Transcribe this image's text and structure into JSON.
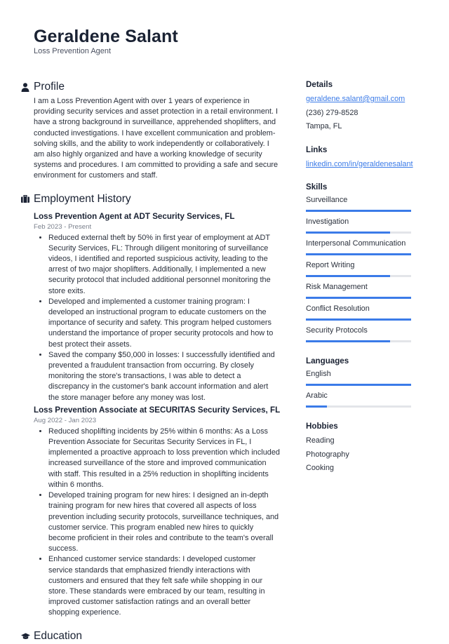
{
  "header": {
    "name": "Geraldene Salant",
    "role": "Loss Prevention Agent"
  },
  "profile": {
    "title": "Profile",
    "icon": "person-icon",
    "text": "I am a Loss Prevention Agent with over 1 years of experience in providing security services and asset protection in a retail environment. I have a strong background in surveillance, apprehended shoplifters, and conducted investigations. I have excellent communication and problem-solving skills, and the ability to work independently or collaboratively. I am also highly organized and have a working knowledge of security systems and procedures. I am committed to providing a safe and secure environment for customers and staff."
  },
  "employment": {
    "title": "Employment History",
    "icon": "briefcase-icon",
    "jobs": [
      {
        "title": "Loss Prevention Agent at ADT Security Services, FL",
        "dates": "Feb 2023 - Present",
        "bullets": [
          "Reduced external theft by 50% in first year of employment at ADT Security Services, FL: Through diligent monitoring of surveillance videos, I identified and reported suspicious activity, leading to the arrest of two major shoplifters. Additionally, I implemented a new security protocol that included additional personnel monitoring the store exits.",
          "Developed and implemented a customer training program: I developed an instructional program to educate customers on the importance of security and safety. This program helped customers understand the importance of proper security protocols and how to best protect their assets.",
          "Saved the company $50,000 in losses: I successfully identified and prevented a fraudulent transaction from occurring. By closely monitoring the store's transactions, I was able to detect a discrepancy in the customer's bank account information and alert the store manager before any money was lost."
        ]
      },
      {
        "title": "Loss Prevention Associate at SECURITAS Security Services, FL",
        "dates": "Aug 2022 - Jan 2023",
        "bullets": [
          "Reduced shoplifting incidents by 25% within 6 months: As a Loss Prevention Associate for Securitas Security Services in FL, I implemented a proactive approach to loss prevention which included increased surveillance of the store and improved communication with staff. This resulted in a 25% reduction in shoplifting incidents within 6 months.",
          "Developed training program for new hires: I designed an in-depth training program for new hires that covered all aspects of loss prevention including security protocols, surveillance techniques, and customer service. This program enabled new hires to quickly become proficient in their roles and contribute to the team's overall success.",
          "Enhanced customer service standards: I developed customer service standards that emphasized friendly interactions with customers and ensured that they felt safe while shopping in our store. These standards were embraced by our team, resulting in improved customer satisfaction ratings and an overall better shopping experience."
        ]
      }
    ]
  },
  "education": {
    "title": "Education",
    "icon": "graduation-cap-icon"
  },
  "details": {
    "title": "Details",
    "email": "geraldene.salant@gmail.com",
    "phone": "(236) 279-8528",
    "location": "Tampa, FL"
  },
  "links": {
    "title": "Links",
    "items": [
      "linkedin.com/in/geraldenesalant"
    ]
  },
  "skills": {
    "title": "Skills",
    "items": [
      {
        "label": "Surveillance",
        "level": 1.0
      },
      {
        "label": "Investigation",
        "level": 0.8
      },
      {
        "label": "Interpersonal Communication",
        "level": 1.0
      },
      {
        "label": "Report Writing",
        "level": 0.8
      },
      {
        "label": "Risk Management",
        "level": 1.0
      },
      {
        "label": "Conflict Resolution",
        "level": 1.0
      },
      {
        "label": "Security Protocols",
        "level": 0.8
      }
    ]
  },
  "languages": {
    "title": "Languages",
    "items": [
      {
        "label": "English",
        "level": 1.0
      },
      {
        "label": "Arabic",
        "level": 0.2
      }
    ]
  },
  "hobbies": {
    "title": "Hobbies",
    "items": [
      "Reading",
      "Photography",
      "Cooking"
    ]
  },
  "colors": {
    "accent": "#3b7be8",
    "bar_track": "#e3e5e9",
    "heading": "#1a2233",
    "muted": "#7a808c"
  }
}
